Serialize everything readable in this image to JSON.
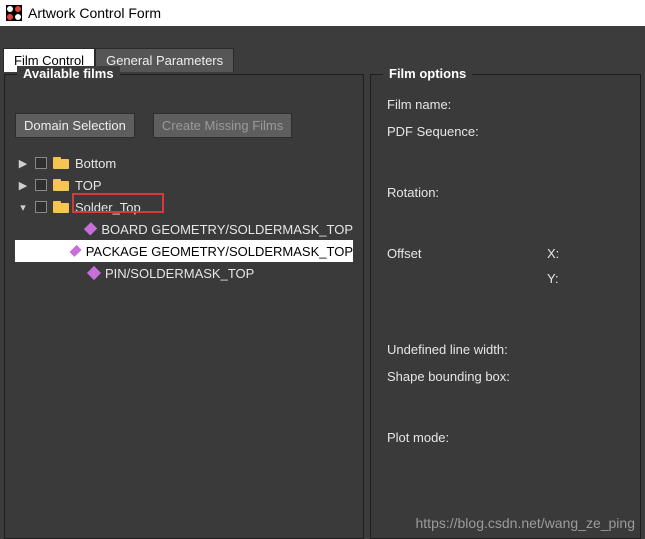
{
  "window": {
    "title": "Artwork Control Form"
  },
  "tabs": {
    "film_control": "Film Control",
    "general_parameters": "General Parameters"
  },
  "available_films": {
    "legend": "Available films",
    "btn_domain_selection": "Domain Selection",
    "btn_create_missing": "Create Missing Films",
    "items": [
      {
        "label": "Bottom"
      },
      {
        "label": "TOP"
      },
      {
        "label": "Solder_Top"
      }
    ],
    "children": [
      {
        "label": "BOARD GEOMETRY/SOLDERMASK_TOP"
      },
      {
        "label": "PACKAGE GEOMETRY/SOLDERMASK_TOP"
      },
      {
        "label": "PIN/SOLDERMASK_TOP"
      }
    ]
  },
  "film_options": {
    "legend": "Film options",
    "film_name": "Film name:",
    "pdf_sequence": "PDF Sequence:",
    "rotation": "Rotation:",
    "offset": "Offset",
    "x": "X:",
    "y": "Y:",
    "undef_line_width": "Undefined line width:",
    "shape_bb": "Shape bounding box:",
    "plot_mode": "Plot mode:"
  },
  "watermark": "https://blog.csdn.net/wang_ze_ping"
}
